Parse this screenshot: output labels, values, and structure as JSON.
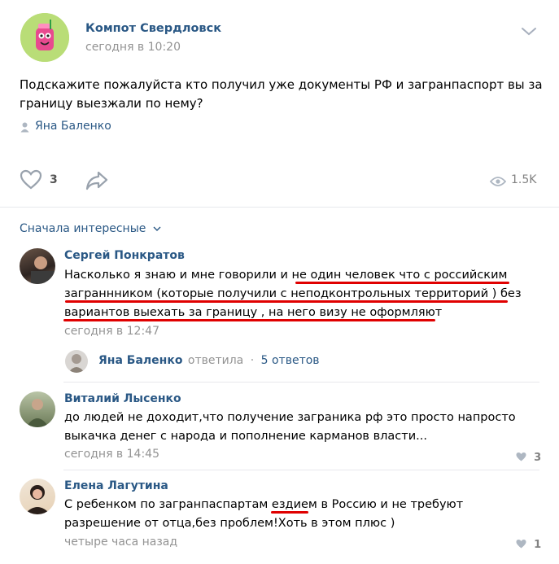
{
  "post": {
    "author": "Компот Свердловск",
    "time": "сегодня в 10:20",
    "text_line1": "Подскажите пожалуйста кто получил уже документы РФ и загранпаспорт вы за",
    "text_line2": "границу выезжали по нему?",
    "signer": "Яна Баленко",
    "likes": "3",
    "views": "1.5K"
  },
  "comments_header": {
    "sort_label": "Сначала интересные"
  },
  "comments": [
    {
      "author": "Сергей Понкратов",
      "line1": "Насколько я знаю и мне говорили и не один человек что с российским",
      "line2": "заграннником (которые получили с неподконтрольных территорий ) без",
      "line3": "вариантов выехать за границу , на него визу не оформляют",
      "time": "сегодня в 12:47",
      "reply_author": "Яна Баленко",
      "reply_action": "ответила",
      "reply_sep": "·",
      "reply_count": "5 ответов"
    },
    {
      "author": "Виталий Лысенко",
      "line1": "до людей не доходит,что получение заграника рф это просто напросто",
      "line2": "выкачка денег с народа и пополнение карманов власти...",
      "time": "сегодня в 14:45",
      "likes": "3"
    },
    {
      "author": "Елена Лагутина",
      "line1": "С ребенком по загранпаспартам ездием в Россию и не требуют",
      "line2": "разрешение от отца,без проблем!Хоть в этом плюс )",
      "time": "четыре часа назад",
      "likes": "1"
    }
  ],
  "colors": {
    "link": "#2a5885",
    "muted": "#939393",
    "highlight": "#e00000"
  }
}
